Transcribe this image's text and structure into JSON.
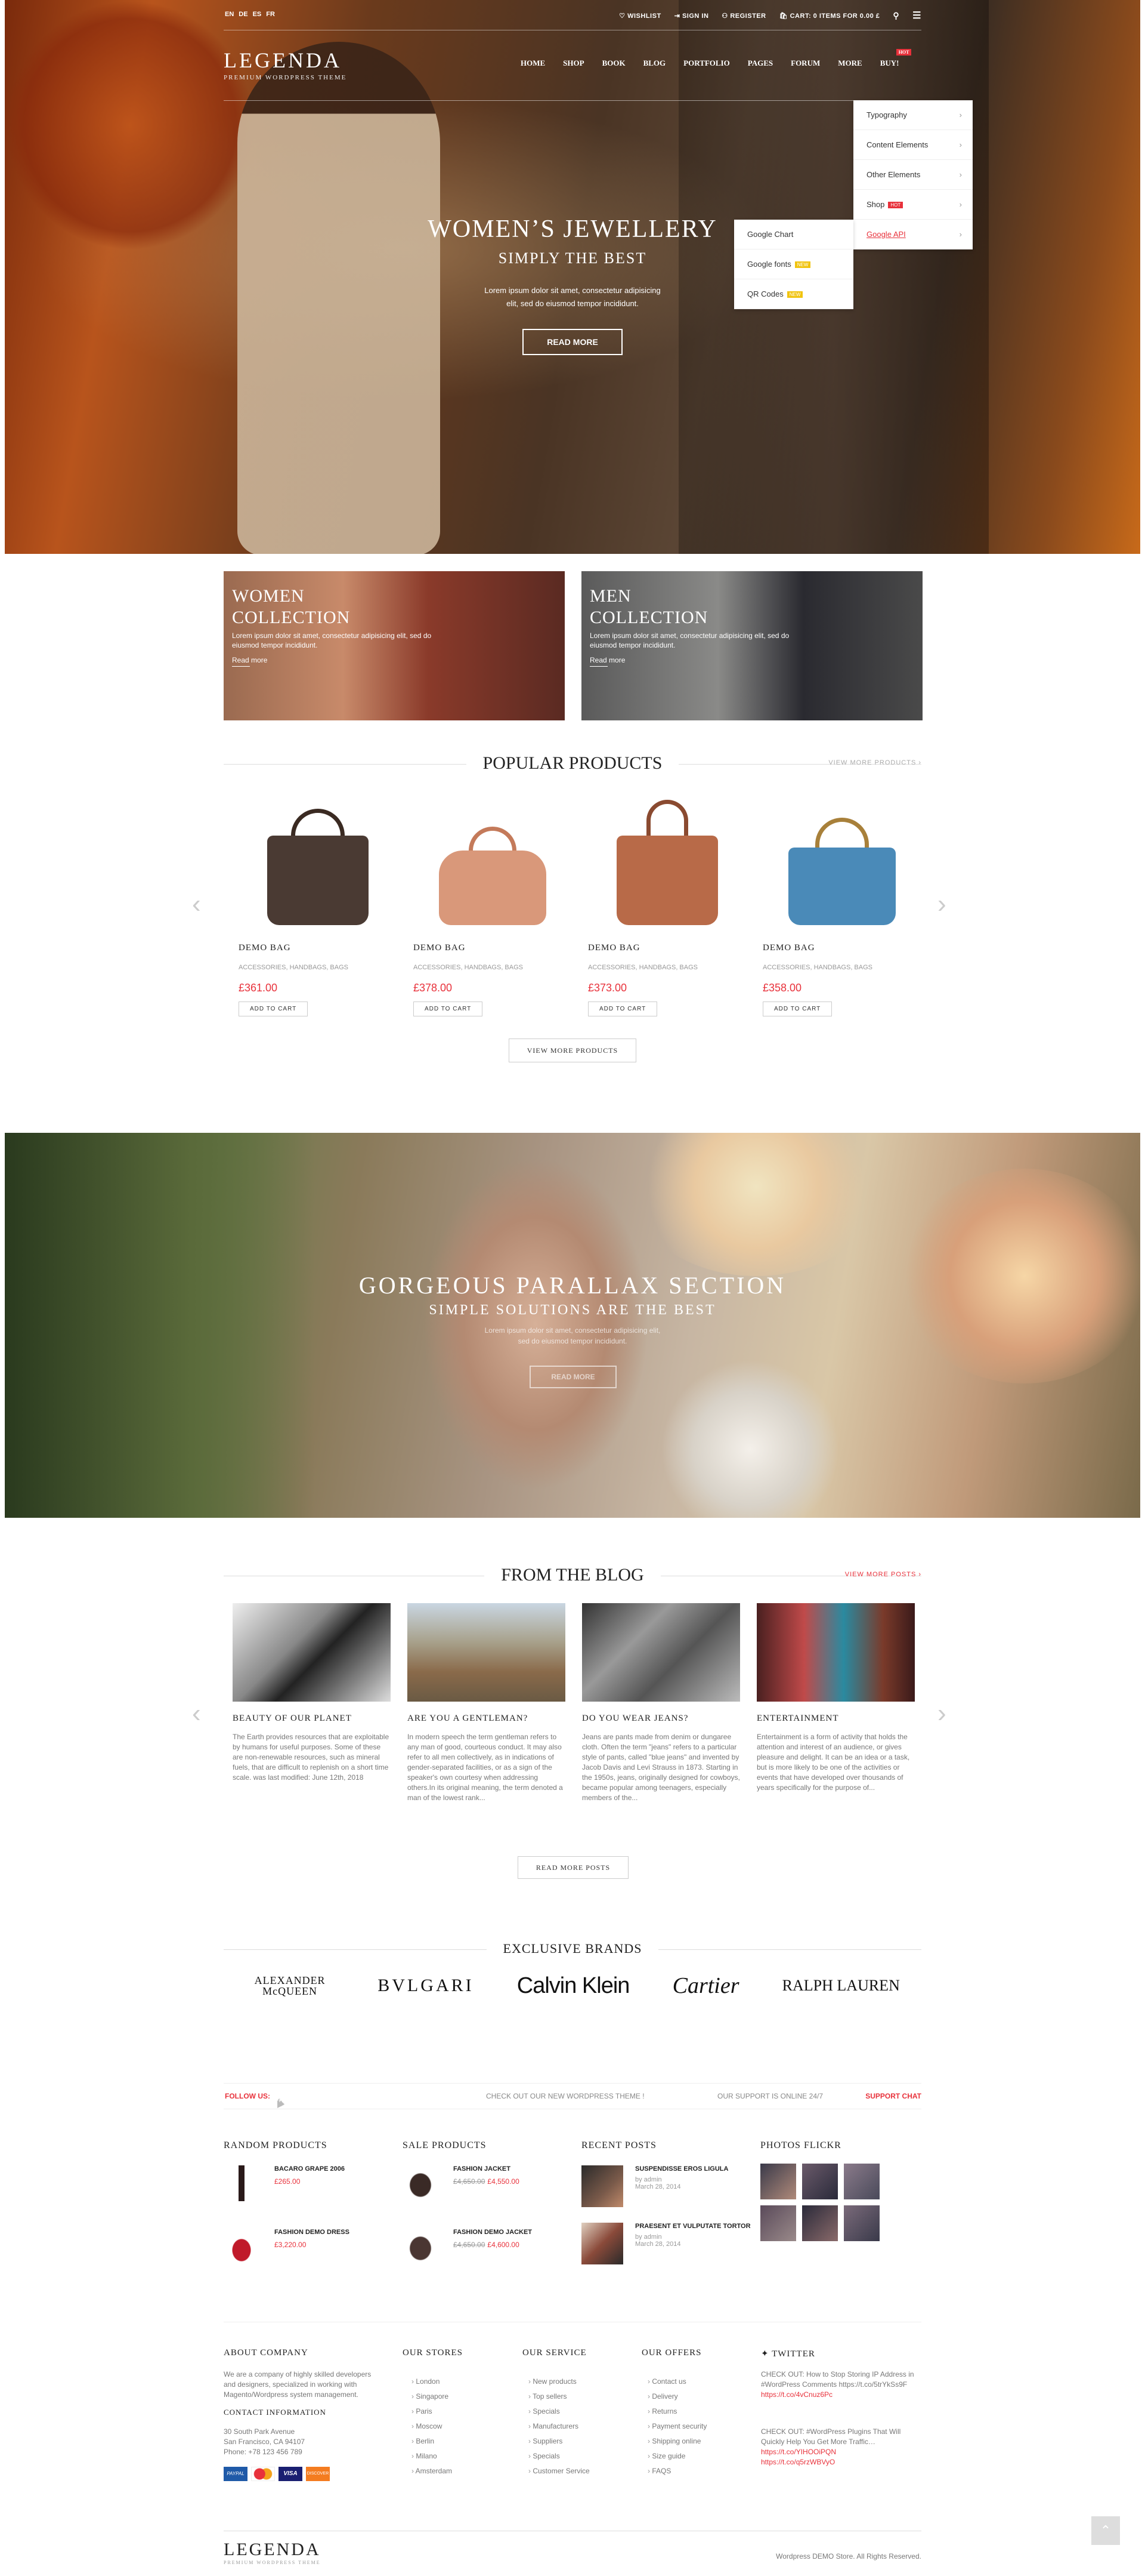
{
  "topbar": {
    "languages": [
      "EN",
      "DE",
      "ES",
      "FR"
    ],
    "wishlist": "WISHLIST",
    "signin": "SIGN IN",
    "register": "REGISTER",
    "cart": "CART: 0 ITEMS FOR",
    "cart_total": "0.00 £"
  },
  "logo": {
    "name": "LEGENDA",
    "tagline": "PREMIUM WORDPRESS THEME"
  },
  "nav": [
    "HOME",
    "SHOP",
    "BOOK",
    "BLOG",
    "PORTFOLIO",
    "PAGES",
    "FORUM",
    "MORE",
    "BUY!"
  ],
  "nav_hot": "HOT",
  "dropdown": [
    {
      "label": "Typography"
    },
    {
      "label": "Content Elements"
    },
    {
      "label": "Other Elements"
    },
    {
      "label": "Shop",
      "badge": "HOT"
    },
    {
      "label": "Google API"
    }
  ],
  "subdropdown": [
    {
      "label": "Google Chart"
    },
    {
      "label": "Google fonts",
      "badge": "NEW"
    },
    {
      "label": "QR Codes",
      "badge": "NEW"
    }
  ],
  "hero": {
    "title": "WOMEN’S JEWELLERY",
    "subtitle": "SIMPLY THE BEST",
    "text_line1": "Lorem ipsum dolor sit amet, consectetur adipisicing",
    "text_line2": "elit, sed do eiusmod tempor incididunt.",
    "button": "READ MORE"
  },
  "collections": [
    {
      "title_line1": "WOMEN",
      "title_line2": "COLLECTION",
      "text": "Lorem ipsum dolor sit amet, consectetur adipisicing elit, sed do eiusmod tempor incididunt.",
      "link": "Read more"
    },
    {
      "title_line1": "MEN",
      "title_line2": "COLLECTION",
      "text": "Lorem ipsum dolor sit amet, consectetur adipisicing elit, sed do eiusmod tempor incididunt.",
      "link": "Read more"
    }
  ],
  "popular": {
    "title": "POPULAR PRODUCTS",
    "view_more": "VIEW MORE PRODUCTS ›",
    "button": "VIEW MORE PRODUCTS",
    "products": [
      {
        "name": "DEMO BAG",
        "cats": "ACCESSORIES, HANDBAGS, BAGS",
        "price": "£361.00",
        "add": "ADD TO CART",
        "color": "#4a3a33"
      },
      {
        "name": "DEMO BAG",
        "cats": "ACCESSORIES, HANDBAGS, BAGS",
        "price": "£378.00",
        "add": "ADD TO CART",
        "color": "#d9987a"
      },
      {
        "name": "DEMO BAG",
        "cats": "ACCESSORIES, HANDBAGS, BAGS",
        "price": "£373.00",
        "add": "ADD TO CART",
        "color": "#b86a48"
      },
      {
        "name": "DEMO BAG",
        "cats": "ACCESSORIES, HANDBAGS, BAGS",
        "price": "£358.00",
        "add": "ADD TO CART",
        "color": "#4a8ab8"
      }
    ]
  },
  "parallax": {
    "title": "GORGEOUS PARALLAX SECTION",
    "subtitle": "SIMPLE SOLUTIONS ARE THE BEST",
    "text": "Lorem ipsum dolor sit amet, consectetur adipisicing elit, sed do eiusmod tempor incididunt.",
    "button": "READ MORE"
  },
  "blog": {
    "title": "FROM THE BLOG",
    "view_more": "VIEW MORE POSTS ›",
    "button": "READ MORE POSTS",
    "posts": [
      {
        "title": "BEAUTY OF OUR PLANET",
        "text": "The Earth provides resources that are exploitable by humans for useful purposes. Some of these are non-renewable resources, such as mineral fuels, that are difficult to replenish on a short time scale. was last modified: June 12th, 2018"
      },
      {
        "title": "ARE YOU A GENTLEMAN?",
        "text": "In modern speech the term gentleman refers to any man of good, courteous conduct. It may also refer to all men collectively, as in indications of gender-separated facilities, or as a sign of the speaker's own courtesy when addressing others.In its original meaning, the term denoted a man of the lowest rank..."
      },
      {
        "title": "DO YOU WEAR JEANS?",
        "text": "Jeans are pants made from denim or dungaree cloth. Often the term \"jeans\" refers to a particular style of pants, called \"blue jeans\" and invented by Jacob Davis and Levi Strauss in 1873. Starting in the 1950s, jeans, originally designed for cowboys, became popular among teenagers, especially members of the..."
      },
      {
        "title": "ENTERTAINMENT",
        "text": "Entertainment is a form of activity that holds the attention and interest of an audience, or gives pleasure and delight. It can be an idea or a task, but is more likely to be one of the activities or events that have developed over thousands of years specifically for the purpose of..."
      }
    ]
  },
  "brands": {
    "title": "EXCLUSIVE BRANDS",
    "items": [
      "ALEXANDER McQUEEN",
      "BVLGARI",
      "Calvin Klein",
      "Cartier",
      "RALPH LAUREN"
    ]
  },
  "strip": {
    "follow": "FOLLOW US:",
    "middle": "CHECK OUT OUR NEW WORDPRESS THEME !",
    "support": "OUR SUPPORT IS ONLINE 24/7",
    "chat": "SUPPORT CHAT"
  },
  "random_products": {
    "title": "RANDOM PRODUCTS",
    "items": [
      {
        "name": "BACARO GRAPE 2006",
        "price": "£265.00"
      },
      {
        "name": "FASHION DEMO DRESS",
        "price": "£3,220.00"
      }
    ]
  },
  "sale_products": {
    "title": "SALE PRODUCTS",
    "items": [
      {
        "name": "FASHION JACKET",
        "old": "£4,650.00",
        "price": "£4,550.00"
      },
      {
        "name": "FASHION DEMO JACKET",
        "old": "£4,650.00",
        "price": "£4,600.00"
      }
    ]
  },
  "recent_posts": {
    "title": "RECENT POSTS",
    "items": [
      {
        "title": "SUSPENDISSE EROS LIGULA",
        "by": "by admin",
        "date": "March 28, 2014"
      },
      {
        "title": "PRAESENT ET VULPUTATE TORTOR",
        "by": "by admin",
        "date": "March 28, 2014"
      }
    ]
  },
  "flickr": {
    "title": "PHOTOS FLICKR"
  },
  "footer": {
    "about_title": "ABOUT COMPANY",
    "about_text": "We are a company of highly skilled developers and designers, specialized in working with Magento/Wordpress system management.",
    "contact_title": "CONTACT INFORMATION",
    "contact_text": "30 South Park Avenue\nSan Francisco, CA 94107\nPhone: +78 123 456 789",
    "payments": [
      "PAYPAL",
      "MC",
      "VISA",
      "DISCOVER"
    ],
    "stores_title": "OUR STORES",
    "stores": [
      "London",
      "Singapore",
      "Paris",
      "Moscow",
      "Berlin",
      "Milano",
      "Amsterdam"
    ],
    "service_title": "OUR SERVICE",
    "service": [
      "New products",
      "Top sellers",
      "Specials",
      "Manufacturers",
      "Suppliers",
      "Specials",
      "Customer Service"
    ],
    "offers_title": "OUR OFFERS",
    "offers": [
      "Contact us",
      "Delivery",
      "Returns",
      "Payment security",
      "Shipping online",
      "Size guide",
      "FAQS"
    ],
    "twitter_title": "TWITTER",
    "tweet1": "CHECK OUT: How to Stop Storing IP Address in #WordPress Comments https://t.co/5trYkSs9F",
    "tweet1_link": "https://t.co/4vCnuz6Pc",
    "tweet2": "CHECK OUT: #WordPress Plugins That Will Quickly Help You Get More Traffic…",
    "tweet2_link1": "https://t.co/YIHOOiPQN",
    "tweet2_link2": "https://t.co/q5rzWBVyO",
    "copyright": "Wordpress DEMO Store. All Rights Reserved.",
    "logo": "LEGENDA",
    "logo_tag": "PREMIUM WORDPRESS THEME"
  }
}
